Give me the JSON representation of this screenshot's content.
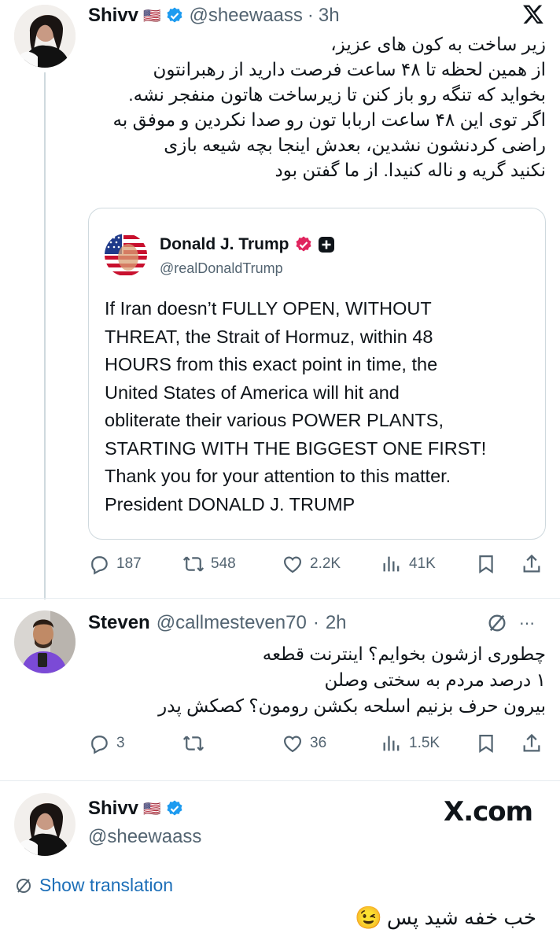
{
  "tweet": {
    "author_name": "Shivv",
    "author_flag": "🇺🇸",
    "author_handle": "@sheewaass",
    "time": "3h",
    "text_lines": [
      "زیر ساخت به کون های عزیز،",
      "از همین لحظه تا ۴۸ ساعت فرصت دارید از رهبرانتون",
      "بخواید که تنگه رو باز کنن تا زیرساخت هاتون منفجر نشه.",
      "اگر توی این ۴۸ ساعت اربابا تون رو صدا نکردین و موفق به",
      "راضی کردنشون نشدین، بعدش اینجا بچه شیعه بازی",
      "نکنید گریه و ناله کنیدا. از ما گفتن بود"
    ],
    "quote": {
      "author_name": "Donald J. Trump",
      "author_handle": "@realDonaldTrump",
      "text_lines": [
        "If Iran doesn’t FULLY OPEN, WITHOUT",
        "THREAT, the Strait of Hormuz, within 48",
        "HOURS from this exact point in time, the",
        "United States of America will hit and",
        "obliterate their various POWER PLANTS,",
        "STARTING WITH THE BIGGEST ONE FIRST!",
        "Thank you for your attention to this matter.",
        "President DONALD J. TRUMP"
      ]
    },
    "stats": {
      "replies": "187",
      "reposts": "548",
      "likes": "2.2K",
      "views": "41K"
    }
  },
  "reply": {
    "author_name": "Steven",
    "author_handle": "@callmesteven70",
    "time": "2h",
    "text_lines": [
      "چطوری ازشون بخوایم؟ اینترنت قطعه",
      "۱ درصد مردم به سختی وصلن",
      "بیرون حرف بزنیم اسلحه بکشن رومون؟ کصکش پدر"
    ],
    "stats": {
      "replies": "3",
      "reposts": "",
      "likes": "36",
      "views": "1.5K"
    }
  },
  "final_tweet": {
    "author_name": "Shivv",
    "author_flag": "🇺🇸",
    "author_handle": "@sheewaass",
    "watermark": "X.com",
    "show_translation": "Show translation",
    "text": "خب خفه شید پس",
    "emoji": "😉"
  },
  "colors": {
    "verified": "#1d9bf0",
    "trump_verified": "#e0245e",
    "link": "#1d6fb8",
    "muted": "#536471"
  }
}
